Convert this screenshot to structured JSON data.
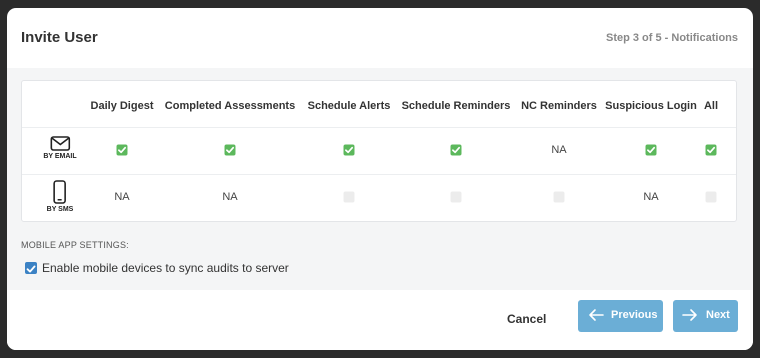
{
  "dialog": {
    "title": "Invite User",
    "step": "Step 3 of 5 - Notifications"
  },
  "table": {
    "columns": [
      "Daily Digest",
      "Completed Assessments",
      "Schedule Alerts",
      "Schedule Reminders",
      "NC Reminders",
      "Suspicious Login",
      "All"
    ],
    "rows": [
      {
        "label": "BY EMAIL",
        "icon": "envelope-icon",
        "cells": [
          {
            "state": "checked"
          },
          {
            "state": "checked"
          },
          {
            "state": "checked"
          },
          {
            "state": "checked"
          },
          {
            "state": "na",
            "text": "NA"
          },
          {
            "state": "checked"
          },
          {
            "state": "checked"
          }
        ]
      },
      {
        "label": "BY SMS",
        "icon": "smartphone-icon",
        "cells": [
          {
            "state": "na",
            "text": "NA"
          },
          {
            "state": "na",
            "text": "NA"
          },
          {
            "state": "disabled"
          },
          {
            "state": "disabled"
          },
          {
            "state": "disabled"
          },
          {
            "state": "na",
            "text": "NA"
          },
          {
            "state": "disabled"
          }
        ]
      }
    ]
  },
  "mobile": {
    "section_label": "MOBILE APP SETTINGS:",
    "sync_label": "Enable mobile devices to sync audits to server",
    "sync_checked": true
  },
  "footer": {
    "cancel_label": "Cancel",
    "previous_label": "Previous",
    "next_label": "Next"
  },
  "colors": {
    "check_green": "#5cb85c",
    "button_blue": "#6baed6",
    "checkbox_blue": "#3b82c4"
  }
}
